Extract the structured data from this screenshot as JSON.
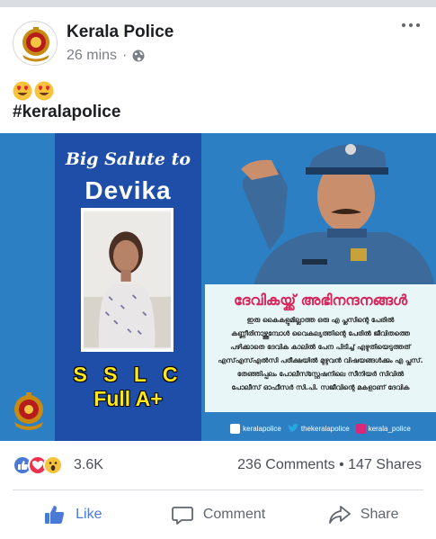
{
  "post": {
    "page_name": "Kerala Police",
    "time": "26 mins",
    "separator": "·",
    "emojis": [
      "heart-eyes-emoji",
      "heart-eyes-emoji"
    ],
    "hashtag": "#keralapolice"
  },
  "image": {
    "salute": "Big Salute to",
    "name": "Devika",
    "exam": "S S L C",
    "grade": "Full A+",
    "ml_title": "ദേവികയ്ക്ക് അഭിനന്ദനങ്ങൾ",
    "ml_lines": [
      "ഇരു കൈകളുമില്ലാത്ത ഒരു എ പ്ലസിന്റെ പേരിൽ",
      "കണ്ണീരിനാഴ്ത്തുമ്പോൾ വൈകല്യത്തിന്റെ പേരിൽ ജീവിതത്തെ",
      "പഴിക്കാതെ ദേവിക കാലിൽ പേന പിടിച്ച് എഴുതിയെടുത്തത്",
      "എസ്എസ്എൽസി പരീക്ഷയിൽ മുഴുവൻ വിഷയങ്ങൾക്കും എ പ്ലസ്.",
      "തേഞ്ഞിപ്പലം പോലീസ്സ്റ്റേഷനിലെ സീനിയർ സിവിൽ",
      "പോലീസ് ഓഫീസർ സി.പി. സജീവിന്റെ മകളാണ് ദേവിക"
    ],
    "social": {
      "facebook": "keralapolice",
      "twitter": "thekeralapolice",
      "instagram": "kerala_police"
    }
  },
  "reactions": {
    "count": "3.6K",
    "comments": "236 Comments",
    "dot": "•",
    "shares": "147 Shares"
  },
  "actions": {
    "like": "Like",
    "comment": "Comment",
    "share": "Share"
  },
  "colors": {
    "like_blue": "#4b7ad6",
    "image_blue": "#2d7fc3",
    "panel_blue": "#1f4ea8",
    "title_pink": "#d7265b",
    "grade_yellow": "#ffe71c"
  }
}
